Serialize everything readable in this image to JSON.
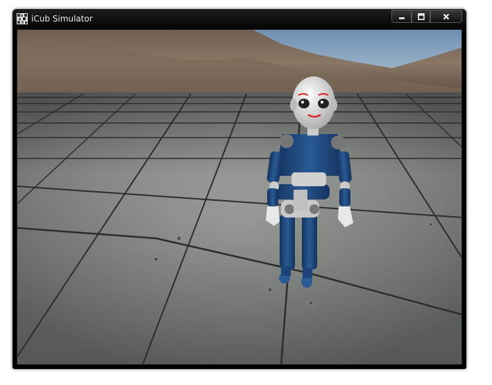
{
  "window": {
    "title": "iCub Simulator",
    "icon": "app-icon",
    "buttons": [
      "minimize-icon",
      "maximize-icon",
      "close-icon"
    ]
  },
  "scene": {
    "description_free": true
  }
}
